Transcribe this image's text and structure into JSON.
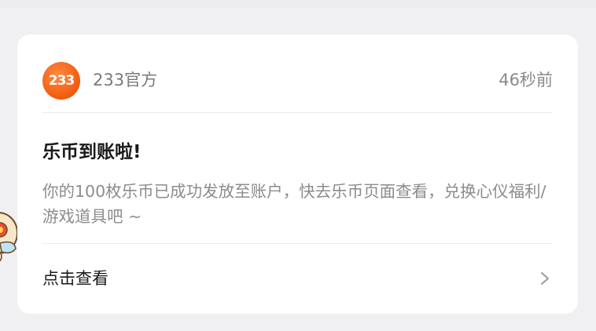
{
  "notification": {
    "sender": "233官方",
    "logo_text": "233",
    "time": "46秒前",
    "title": "乐币到账啦!",
    "body": "你的100枚乐币已成功发放至账户，快去乐币页面查看，兑换心仪福利/游戏道具吧 ~",
    "action_label": "点击查看"
  },
  "icons": {
    "logo": "233-logo-icon",
    "action": "chevron-right-icon",
    "sticker": "cartoon-sticker-icon"
  },
  "colors": {
    "logo_orange": "#f25a0f",
    "background": "#f0f0f2",
    "card": "#ffffff"
  }
}
